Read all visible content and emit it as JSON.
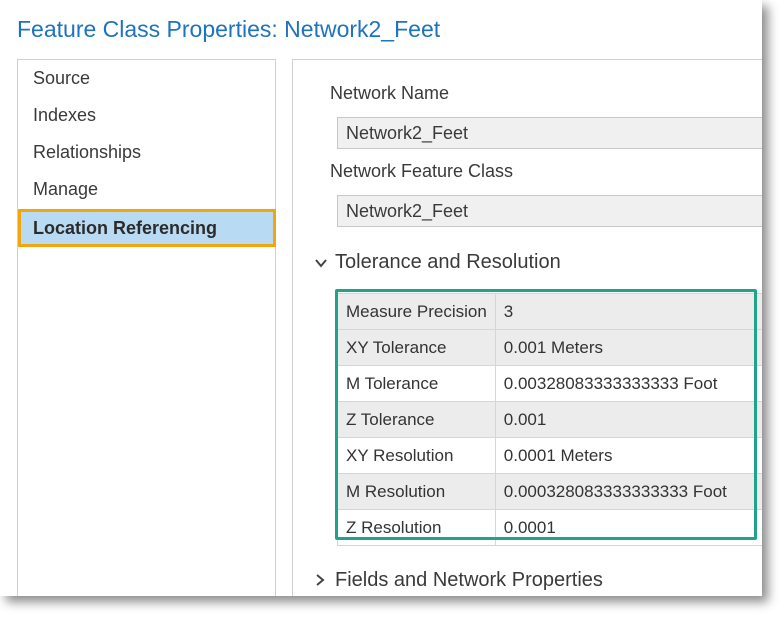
{
  "dialog": {
    "title": "Feature Class Properties: Network2_Feet"
  },
  "nav": {
    "items": [
      {
        "label": "Source"
      },
      {
        "label": "Indexes"
      },
      {
        "label": "Relationships"
      },
      {
        "label": "Manage"
      },
      {
        "label": "Location Referencing"
      }
    ],
    "selected": "Location Referencing"
  },
  "content": {
    "network_name_label": "Network Name",
    "network_name_value": "Network2_Feet",
    "network_fc_label": "Network Feature Class",
    "network_fc_value": "Network2_Feet",
    "tolerance_section": "Tolerance and Resolution",
    "fields_section": "Fields and Network Properties",
    "properties": [
      {
        "key": "Measure Precision",
        "value": "3"
      },
      {
        "key": "XY Tolerance",
        "value": "0.001 Meters"
      },
      {
        "key": "M Tolerance",
        "value": "0.00328083333333333 Foot"
      },
      {
        "key": "Z Tolerance",
        "value": "0.001"
      },
      {
        "key": "XY Resolution",
        "value": "0.0001 Meters"
      },
      {
        "key": "M Resolution",
        "value": "0.000328083333333333 Foot"
      },
      {
        "key": "Z Resolution",
        "value": "0.0001"
      }
    ]
  },
  "colors": {
    "title": "#1e73be",
    "selected_bg": "#b9daf3",
    "selected_outline": "#f2a50c",
    "table_highlight": "#1fa38a"
  },
  "icons": {
    "expanded": "chevron-down-icon",
    "collapsed": "chevron-right-icon"
  }
}
